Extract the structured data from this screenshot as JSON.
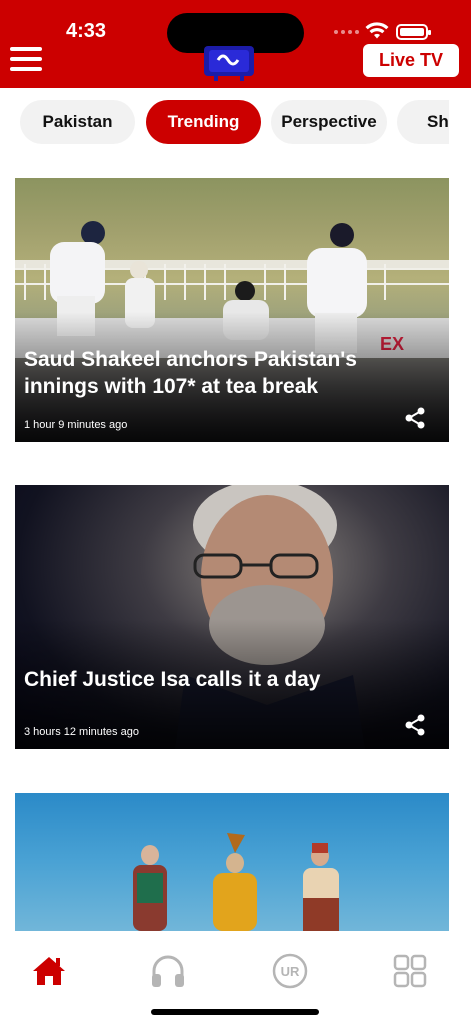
{
  "status_bar": {
    "time": "4:33"
  },
  "header": {
    "live_tv_label": "Live TV",
    "menu_icon": "hamburger-menu-icon",
    "logo_icon": "tv-logo-icon"
  },
  "tabs": [
    {
      "label": "Pakistan",
      "active": false
    },
    {
      "label": "Trending",
      "active": true
    },
    {
      "label": "Perspective",
      "active": false
    },
    {
      "label": "Sh",
      "active": false
    }
  ],
  "articles": [
    {
      "headline": "Saud Shakeel anchors Pakistan's innings with 107* at tea break",
      "time": "1 hour 9 minutes ago"
    },
    {
      "headline": "Chief Justice Isa calls it a day",
      "time": "3 hours 12 minutes ago"
    },
    {
      "headline": "",
      "time": ""
    }
  ],
  "bottom_nav": [
    {
      "name": "home-icon",
      "active": true
    },
    {
      "name": "headphones-icon",
      "active": false
    },
    {
      "name": "ur-language-icon",
      "label": "UR",
      "active": false
    },
    {
      "name": "grid-icon",
      "active": false
    }
  ],
  "colors": {
    "brand": "#cc0000",
    "inactive_icon": "#b5b5b5"
  }
}
